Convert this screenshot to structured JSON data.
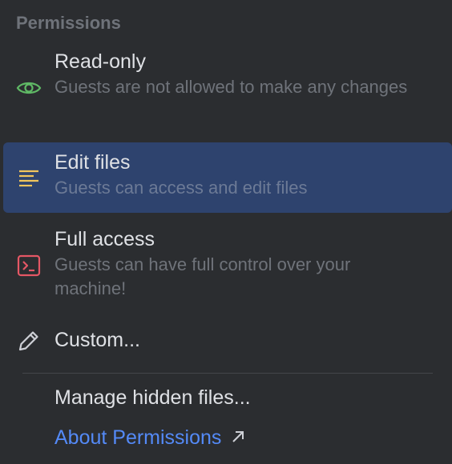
{
  "permissions": {
    "header": "Permissions",
    "options": [
      {
        "title": "Read-only",
        "description": "Guests are not allowed to make any changes",
        "icon": "eye-icon",
        "icon_color": "#5fb865"
      },
      {
        "title": "Edit files",
        "description": "Guests can access and edit files",
        "icon": "lines-icon",
        "icon_color": "#f2c55c",
        "selected": true
      },
      {
        "title": "Full access",
        "description": "Guests can have full control over your machine!",
        "icon": "terminal-icon",
        "icon_color": "#e55765"
      },
      {
        "title": "Custom...",
        "icon": "pencil-icon",
        "icon_color": "#ced0d6"
      }
    ],
    "manage_hidden_files": "Manage hidden files...",
    "about_link": "About Permissions"
  },
  "colors": {
    "background": "#2b2d30",
    "selection": "#2e436e",
    "link": "#548af7",
    "muted_text": "#6f737a"
  }
}
